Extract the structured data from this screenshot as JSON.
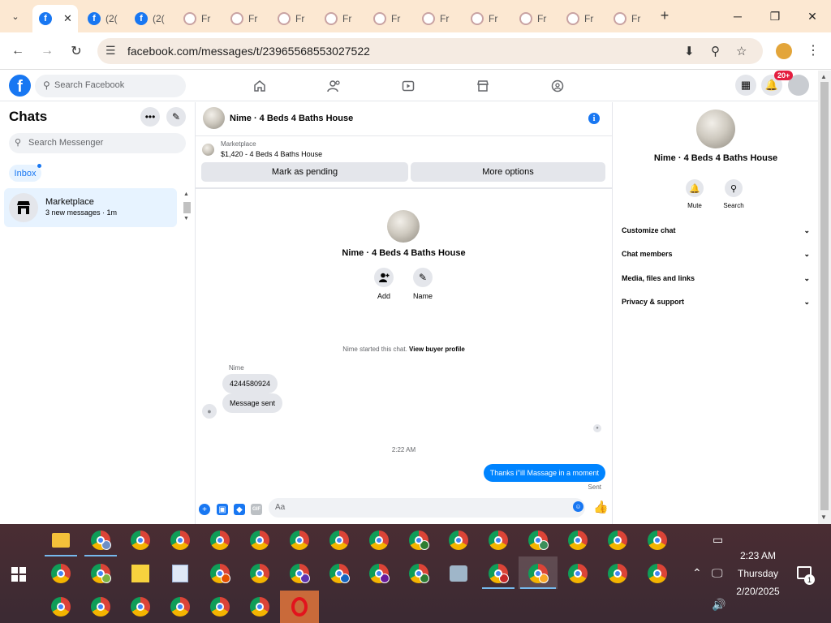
{
  "browser": {
    "tabs": [
      {
        "label": "",
        "icon": "facebook-icon",
        "active": true
      },
      {
        "label": "(2(",
        "icon": "facebook-icon"
      },
      {
        "label": "(2(",
        "icon": "facebook-icon"
      },
      {
        "label": "Fr",
        "icon": "generic-site-icon"
      },
      {
        "label": "Fr",
        "icon": "generic-site-icon"
      },
      {
        "label": "Fr",
        "icon": "generic-site-icon"
      },
      {
        "label": "Fr",
        "icon": "generic-site-icon"
      },
      {
        "label": "Fr",
        "icon": "generic-site-icon"
      },
      {
        "label": "Fr",
        "icon": "generic-site-icon"
      },
      {
        "label": "Fr",
        "icon": "generic-site-icon"
      },
      {
        "label": "Fr",
        "icon": "generic-site-icon"
      },
      {
        "label": "Fr",
        "icon": "generic-site-icon"
      },
      {
        "label": "Fr",
        "icon": "generic-site-icon"
      }
    ],
    "url": "facebook.com/messages/t/23965568553027522"
  },
  "fb_header": {
    "logo": "f",
    "search_placeholder": "Search Facebook",
    "nav_icons": [
      "home-icon",
      "friends-icon",
      "video-icon",
      "marketplace-icon",
      "groups-icon"
    ],
    "notif_badge": "20+"
  },
  "chats": {
    "title": "Chats",
    "search_placeholder": "Search Messenger",
    "filter": "Inbox",
    "items": [
      {
        "name": "Marketplace",
        "sub": "3 new messages · 1m"
      }
    ]
  },
  "conversation": {
    "title": "Nime · 4 Beds 4 Baths House",
    "marketplace_label": "Marketplace",
    "listing": "$1,420 - 4 Beds 4 Baths House",
    "buttons": {
      "pending": "Mark as pending",
      "more": "More options"
    },
    "center_name": "Nime · 4 Beds 4 Baths House",
    "actions": [
      {
        "label": "Add"
      },
      {
        "label": "Name"
      }
    ],
    "started_text": "Nime started this chat.",
    "buyer_profile": "View buyer profile",
    "sender": "Nime",
    "incoming": [
      "4244580924",
      "Message sent"
    ],
    "timestamp": "2:22 AM",
    "outgoing": "Thanks i\"ill Massage in a moment",
    "sent_label": "Sent",
    "composer_placeholder": "Aa",
    "gif_label": "GIF"
  },
  "info_panel": {
    "name": "Nime · 4 Beds 4 Baths House",
    "actions": [
      {
        "label": "Mute"
      },
      {
        "label": "Search"
      }
    ],
    "sections": [
      "Customize chat",
      "Chat members",
      "Media, files and links",
      "Privacy & support"
    ]
  },
  "taskbar": {
    "time": "2:23 AM",
    "day": "Thursday",
    "date": "2/20/2025",
    "notif_count": "1"
  }
}
